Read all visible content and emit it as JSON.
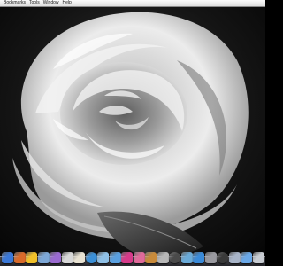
{
  "menubar": {
    "items": [
      "Bookmarks",
      "Tools",
      "Window",
      "Help"
    ]
  },
  "wallpaper": {
    "subject": "white-peony-flower",
    "tone": "grayscale"
  },
  "dock": {
    "icons": [
      {
        "name": "finder-icon",
        "color": "#3a78d8"
      },
      {
        "name": "photos-flower-icon",
        "color": "#d86a2a"
      },
      {
        "name": "chat-duck-icon",
        "color": "#f0c02a"
      },
      {
        "name": "mail-icon",
        "color": "#7da7d6"
      },
      {
        "name": "browser-icon",
        "color": "#9a6ad0"
      },
      {
        "name": "ipod-icon",
        "color": "#d8d8d8"
      },
      {
        "name": "calendar-icon",
        "color": "#e8e2d2"
      },
      {
        "name": "globe-icon",
        "color": "#3b8fd6"
      },
      {
        "name": "itunes-icon",
        "color": "#8fc0e6"
      },
      {
        "name": "iphoto-icon",
        "color": "#5aa0e0"
      },
      {
        "name": "paint-icon",
        "color": "#d63a8a"
      },
      {
        "name": "media-icon",
        "color": "#e06a9a"
      },
      {
        "name": "guitar-icon",
        "color": "#c88a3a"
      },
      {
        "name": "preview-icon",
        "color": "#b8b8b8"
      },
      {
        "name": "utility-icon",
        "color": "#4a4a4a"
      },
      {
        "name": "camera-icon",
        "color": "#6aaad8"
      },
      {
        "name": "app-grid-icon",
        "color": "#3a8ad8"
      },
      {
        "name": "system-preferences-icon",
        "color": "#9a9aa0"
      },
      {
        "name": "dashboard-icon",
        "color": "#3a3a3a"
      },
      {
        "name": "stack-icon",
        "color": "#a8b4c8"
      },
      {
        "name": "folder-icon",
        "color": "#6aa8e8"
      },
      {
        "name": "trash-icon",
        "color": "#c8ccd2"
      }
    ]
  }
}
